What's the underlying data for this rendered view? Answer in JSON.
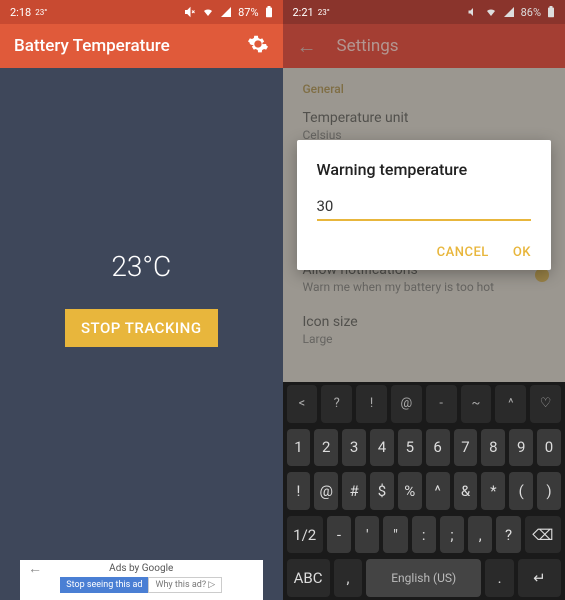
{
  "left": {
    "status": {
      "time": "2:18",
      "temp": "23°",
      "battery": "87%"
    },
    "header": {
      "title": "Battery Temperature"
    },
    "main": {
      "temperature": "23°C",
      "button": "STOP TRACKING"
    },
    "ad": {
      "label": "Ads by Google",
      "stop": "Stop seeing this ad",
      "why": "Why this ad? ▷"
    }
  },
  "right": {
    "status": {
      "time": "2:21",
      "temp": "23°",
      "battery": "86%"
    },
    "header": {
      "back": "←",
      "title": "Settings"
    },
    "settings": {
      "section": "General",
      "items": [
        {
          "title": "Temperature unit",
          "sub": "Celsius"
        },
        {
          "title": "Allow notifications",
          "sub": "Warn me when my battery is too hot"
        },
        {
          "title": "Icon size",
          "sub": "Large"
        }
      ]
    },
    "dialog": {
      "title": "Warning temperature",
      "value": "30",
      "cancel": "CANCEL",
      "ok": "OK"
    },
    "keyboard": {
      "row1": [
        "<",
        "?",
        "!",
        "@",
        "-",
        "~",
        "^",
        "♡"
      ],
      "row2": [
        "1",
        "2",
        "3",
        "4",
        "5",
        "6",
        "7",
        "8",
        "9",
        "0"
      ],
      "row3": [
        "!",
        "@",
        "#",
        "$",
        "%",
        "^",
        "&",
        "*",
        "(",
        ")"
      ],
      "row4": [
        "1/2",
        "-",
        "'",
        "\"",
        ":",
        ";",
        ",",
        "?",
        "⌫"
      ],
      "row5": [
        "ABC",
        ",",
        "English (US)",
        ".",
        "↵"
      ]
    }
  }
}
